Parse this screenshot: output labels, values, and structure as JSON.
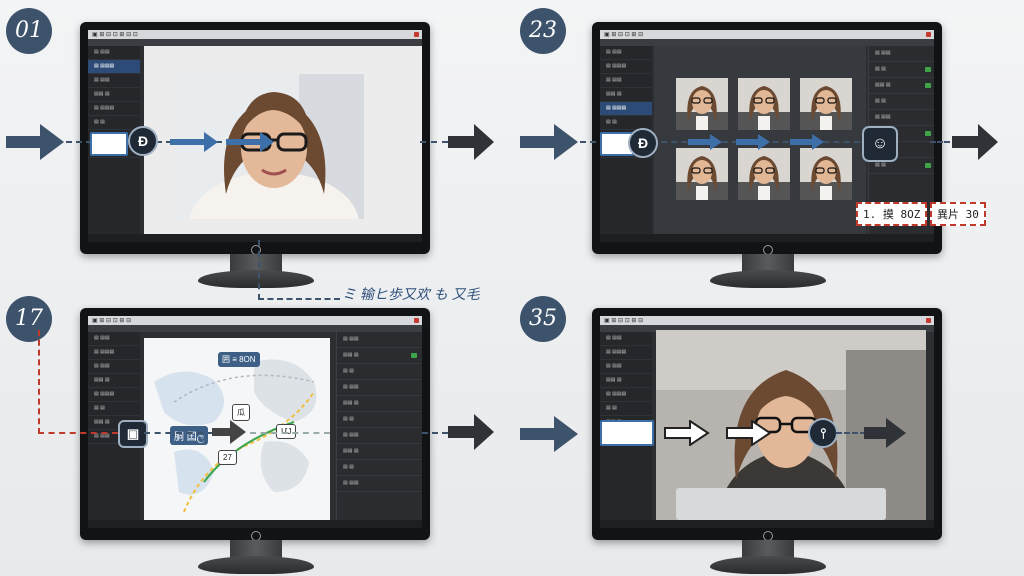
{
  "panels": [
    {
      "step": "01"
    },
    {
      "step": "23"
    },
    {
      "step": "17"
    },
    {
      "step": "35"
    }
  ],
  "annotation_text": "ミ 输ヒ歩又欢 も 又毛",
  "panel2_box_left": "1. 摸 8OZ",
  "panel2_box_right": "異片 30",
  "panel3_tag_top": "囲 ≡ 8ON",
  "panel3_tag_mid": "胴 囯ල",
  "panel3_tag_right": "ՄJ",
  "panel3_tag_small": "瓜",
  "panel3_tag_small2": "27",
  "colors": {
    "arrow": "#3d536b",
    "dashed_red": "#c0392b",
    "bezel": "#121314"
  }
}
